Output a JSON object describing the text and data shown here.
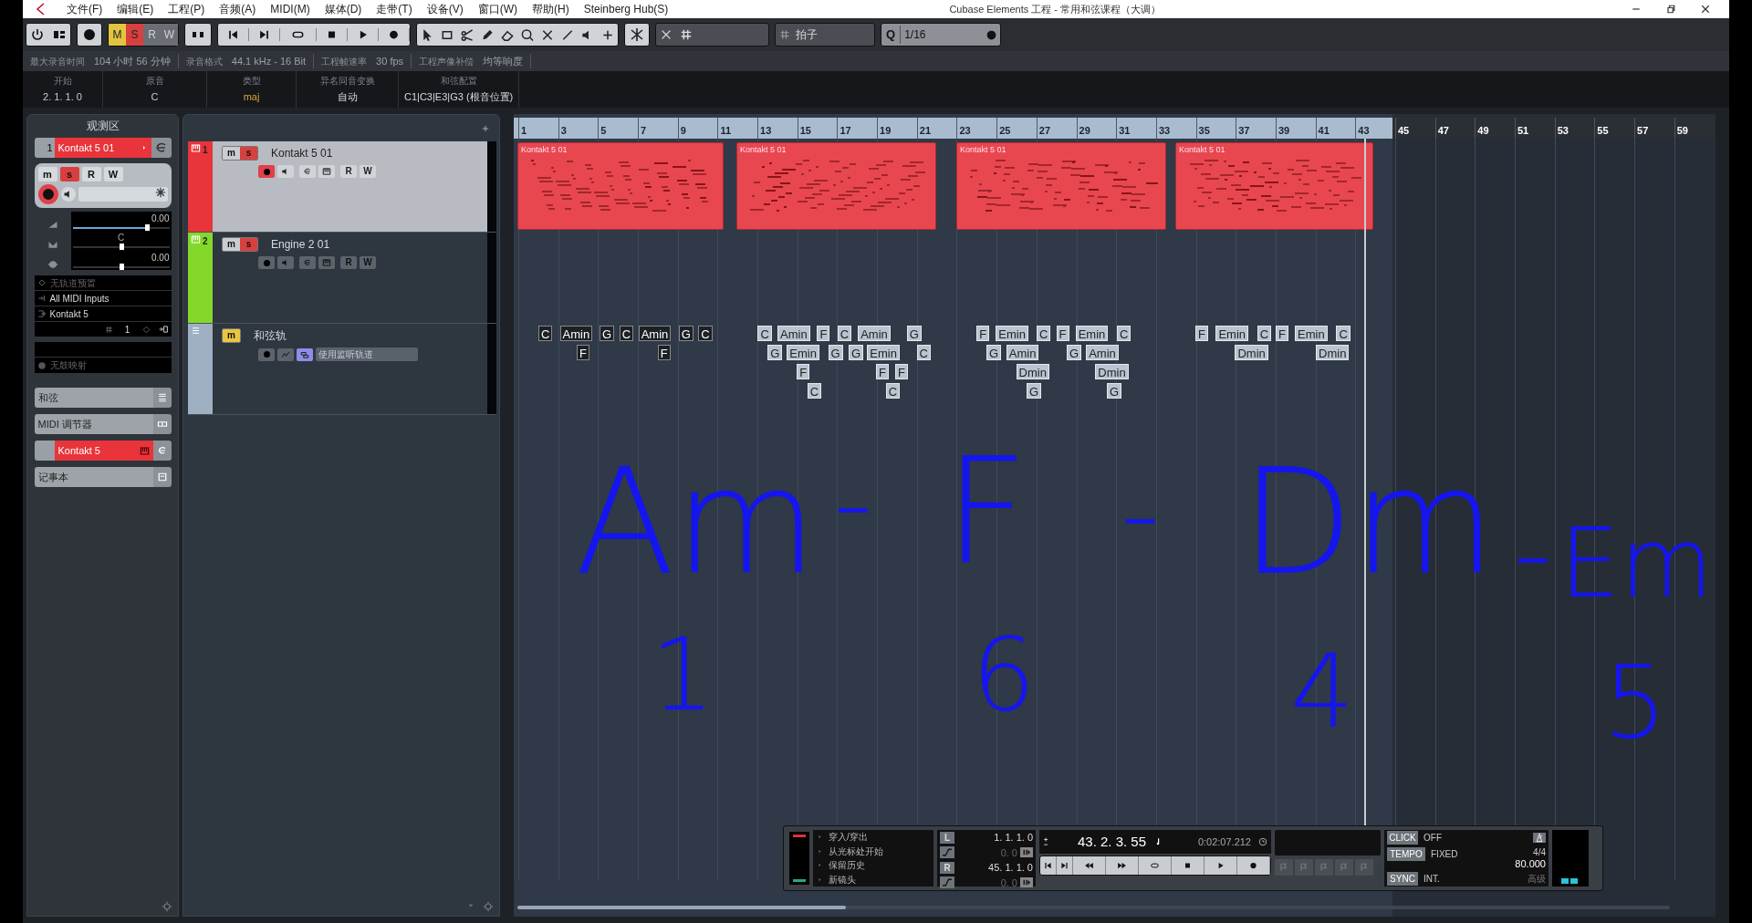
{
  "window": {
    "title": "Cubase Elements 工程 - 常用和弦课程（大调）"
  },
  "menu": [
    "文件(F)",
    "编辑(E)",
    "工程(P)",
    "音频(A)",
    "MIDI(M)",
    "媒体(D)",
    "走带(T)",
    "设备(V)",
    "窗口(W)",
    "帮助(H)",
    "Steinberg Hub(S)"
  ],
  "toolbar": {
    "state_buttons": [
      {
        "kind": "mute",
        "label": "M",
        "on": true
      },
      {
        "kind": "solo",
        "label": "S",
        "on": true
      },
      {
        "kind": "read",
        "label": "R",
        "on": false
      },
      {
        "kind": "write",
        "label": "W",
        "on": false
      }
    ],
    "snap_type": "拍子",
    "quantize_label": "Q",
    "quantize": "1/16"
  },
  "info_line": [
    {
      "label": "最大录音时间",
      "value": "104 小时 56 分钟"
    },
    {
      "label": "录音格式",
      "value": "44.1 kHz - 16 Bit"
    },
    {
      "label": "工程帧速率",
      "value": "30 fps"
    },
    {
      "label": "工程声像补偿",
      "value": "均等响度"
    }
  ],
  "chord_info": [
    {
      "label": "开始",
      "value": "2. 1. 1. 0"
    },
    {
      "label": "原音",
      "value": "C"
    },
    {
      "label": "类型",
      "value": "maj"
    },
    {
      "label": "异名同音变换",
      "value": "自动"
    },
    {
      "label": "和弦配置",
      "value": "C1|C3|E3|G3 (根音位置)"
    }
  ],
  "inspector": {
    "title": "观测区",
    "track_number": "1",
    "track_name": "Kontakt 5 01",
    "buttons": [
      {
        "kind": "mute",
        "label": "m",
        "on": false
      },
      {
        "kind": "solo",
        "label": "s",
        "on": true
      },
      {
        "kind": "read",
        "label": "R",
        "on": false
      },
      {
        "kind": "write",
        "label": "W",
        "on": false
      }
    ],
    "faders": [
      {
        "reading": "0.00",
        "level": 0.77
      },
      {
        "reading": "C",
        "level": 0.5
      },
      {
        "reading": "0.00",
        "level": 0.5
      }
    ],
    "routing": [
      "无轨道预置",
      "All MIDI Inputs",
      "Kontakt 5"
    ],
    "channel": "1",
    "drum_map": "无鼓映射",
    "sections": [
      {
        "label": "和弦",
        "kind": "plain"
      },
      {
        "label": "MIDI 调节器",
        "kind": "plain"
      },
      {
        "label": "Kontakt 5",
        "kind": "instrument"
      },
      {
        "label": "记事本",
        "kind": "plain"
      }
    ]
  },
  "tracks": [
    {
      "number": "1",
      "name": "Kontakt 5 01",
      "kind": "instrument",
      "color": "#e8343a",
      "selected": true,
      "record_armed": true,
      "buttons": [
        {
          "kind": "mute",
          "label": "m",
          "on": false
        },
        {
          "kind": "solo",
          "label": "s",
          "on": true
        }
      ],
      "automation": [
        "R",
        "W"
      ]
    },
    {
      "number": "2",
      "name": "Engine 2 01",
      "kind": "instrument",
      "color": "#84d82a",
      "selected": false,
      "record_armed": false,
      "buttons": [
        {
          "kind": "mute",
          "label": "m",
          "on": false
        },
        {
          "kind": "solo",
          "label": "s",
          "on": true
        }
      ],
      "automation": [
        "R",
        "W"
      ]
    },
    {
      "name": "和弦轨",
      "kind": "chord",
      "color": "#9fb0c2",
      "selected": false,
      "buttons": [
        {
          "kind": "mute",
          "label": "m",
          "on": true
        }
      ],
      "option": "使用监听轨道"
    }
  ],
  "ruler": [
    "1",
    "3",
    "5",
    "7",
    "9",
    "11",
    "13",
    "15",
    "17",
    "19",
    "21",
    "23",
    "25",
    "27",
    "29",
    "31",
    "33",
    "35",
    "37",
    "39",
    "41",
    "43",
    "45",
    "47",
    "49",
    "51",
    "53",
    "55",
    "57",
    "59"
  ],
  "parts": [
    {
      "name": "Kontakt 5 01"
    },
    {
      "name": "Kontakt 5 01"
    },
    {
      "name": "Kontakt 5 01"
    },
    {
      "name": "Kontakt 5 01"
    }
  ],
  "chords": [
    {
      "label": "C",
      "selected": true
    },
    {
      "label": "Amin",
      "selected": true
    },
    {
      "label": "G",
      "selected": true
    },
    {
      "label": "C",
      "selected": true
    },
    {
      "label": "Amin",
      "selected": true
    },
    {
      "label": "G",
      "selected": true
    },
    {
      "label": "C",
      "selected": true
    },
    {
      "label": "F",
      "selected": true
    },
    {
      "label": "F",
      "selected": true
    },
    {
      "label": "C",
      "selected": false
    },
    {
      "label": "Amin",
      "selected": false
    },
    {
      "label": "F",
      "selected": false
    },
    {
      "label": "C",
      "selected": false
    },
    {
      "label": "Amin",
      "selected": false
    },
    {
      "label": "G",
      "selected": false
    },
    {
      "label": "G",
      "selected": false
    },
    {
      "label": "Emin",
      "selected": false
    },
    {
      "label": "G",
      "selected": false
    },
    {
      "label": "G",
      "selected": false
    },
    {
      "label": "Emin",
      "selected": false
    },
    {
      "label": "C",
      "selected": false
    },
    {
      "label": "F",
      "selected": false
    },
    {
      "label": "F",
      "selected": false
    },
    {
      "label": "F",
      "selected": false
    },
    {
      "label": "C",
      "selected": false
    },
    {
      "label": "C",
      "selected": false
    },
    {
      "label": "F",
      "selected": false
    },
    {
      "label": "Emin",
      "selected": false
    },
    {
      "label": "C",
      "selected": false
    },
    {
      "label": "F",
      "selected": false
    },
    {
      "label": "Emin",
      "selected": false
    },
    {
      "label": "C",
      "selected": false
    },
    {
      "label": "G",
      "selected": false
    },
    {
      "label": "Amin",
      "selected": false
    },
    {
      "label": "G",
      "selected": false
    },
    {
      "label": "Amin",
      "selected": false
    },
    {
      "label": "Dmin",
      "selected": false
    },
    {
      "label": "Dmin",
      "selected": false
    },
    {
      "label": "G",
      "selected": false
    },
    {
      "label": "G",
      "selected": false
    },
    {
      "label": "F",
      "selected": false
    },
    {
      "label": "Emin",
      "selected": false
    },
    {
      "label": "C",
      "selected": false
    },
    {
      "label": "F",
      "selected": false
    },
    {
      "label": "Emin",
      "selected": false
    },
    {
      "label": "C",
      "selected": false
    },
    {
      "label": "Dmin",
      "selected": false
    },
    {
      "label": "Dmin",
      "selected": false
    }
  ],
  "handwriting": [
    {
      "text": "Am"
    },
    {
      "text": "-"
    },
    {
      "text": "F"
    },
    {
      "text": "-"
    },
    {
      "text": "Dm"
    },
    {
      "text": "-"
    },
    {
      "text": "Em"
    },
    {
      "text": "1"
    },
    {
      "text": "6"
    },
    {
      "text": "4"
    },
    {
      "text": "5"
    }
  ],
  "transport": {
    "modes": [
      "穿入/穿出",
      "从光标处开始",
      "保留历史",
      "新镜头"
    ],
    "left_label": "L",
    "left_locator": "1. 1. 1. 0",
    "left_offset": "0. 0",
    "right_label": "R",
    "right_locator": "45. 1. 1. 0",
    "right_offset": "0. 0",
    "position": "43. 2. 3. 55",
    "time": "0:02:07.212",
    "click_label": "CLICK",
    "click": "OFF",
    "tempo_label": "TEMPO",
    "tempo_mode": "FIXED",
    "signature": "4/4",
    "bpm": "80.000",
    "sync_label": "SYNC",
    "sync": "INT.",
    "sync_extra": "高级"
  }
}
